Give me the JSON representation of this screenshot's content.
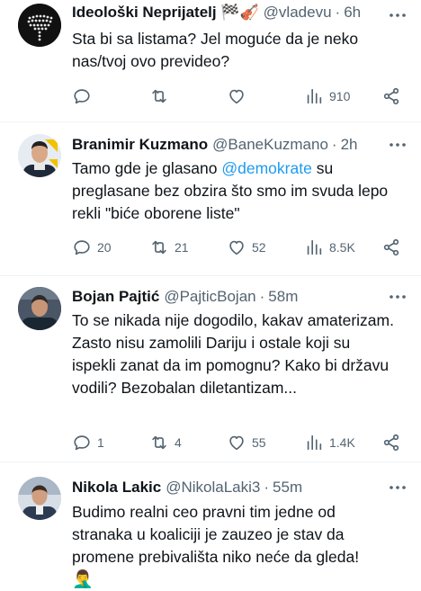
{
  "tweets": [
    {
      "name": "Ideološki Neprijatelj 🏁🎻",
      "handle": "@vladevu",
      "time": "6h",
      "text": "Sta bi sa listama? Jel moguće da je neko nas/tvoj ovo previdео?",
      "replies": "",
      "retweets": "",
      "likes": "",
      "views": "910"
    },
    {
      "name": "Branimir Kuzmano",
      "handle": "@BaneKuzmano",
      "time": "2h",
      "text_before": "Tamo gde je glasano ",
      "mention": "@demokrate",
      "text_after": " su preglasane bez obzira što smo im svuda lepo rekli \"biće oborene liste\"",
      "replies": "20",
      "retweets": "21",
      "likes": "52",
      "views": "8.5K"
    },
    {
      "name": "Bojan Pajtić",
      "handle": "@PajticBojan",
      "time": "58m",
      "text": "To se nikada nije dogodilo, kakav amaterizam. Zasto nisu zamolili Dariju i ostale koji su ispekli zanat da im pomognu? Kako bi državu vodili? Bezobalan diletantizam...",
      "replies": "1",
      "retweets": "4",
      "likes": "55",
      "views": "1.4K"
    },
    {
      "name": "Nikola Lakic",
      "handle": "@NikolaLaki3",
      "time": "55m",
      "text": "Budimo realni ceo pravni tim jedne od stranaka u koaliciji je zauzeo je stav da promene prebivališta niko neće da gleda!",
      "emoji": "🤦‍♂️"
    }
  ],
  "more_glyph": "···",
  "separator": "·",
  "colors": {
    "accent": "#1d9bf0",
    "muted": "#536471",
    "text": "#0f1419"
  }
}
